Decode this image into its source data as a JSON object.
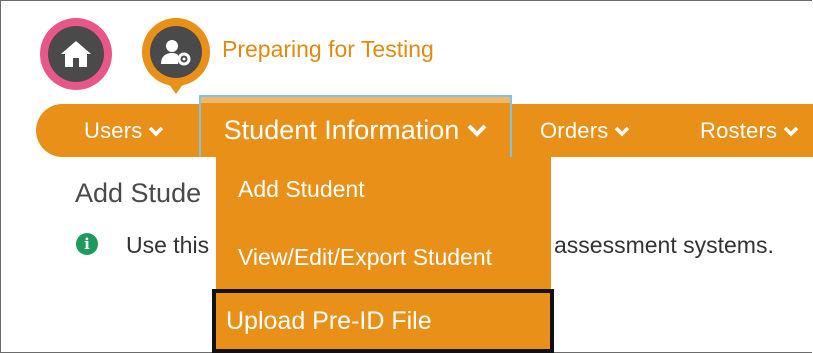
{
  "header": {
    "section_title": "Preparing for Testing",
    "home_icon": "home-icon",
    "section_icon": "user-gear-icon"
  },
  "nav": {
    "items": [
      {
        "label": "Users"
      },
      {
        "label": "Student Information"
      },
      {
        "label": "Orders"
      },
      {
        "label": "Rosters"
      }
    ]
  },
  "dropdown": {
    "items": [
      {
        "label": "Add Student"
      },
      {
        "label": "View/Edit/Export Student"
      },
      {
        "label": "Upload Pre-ID File"
      }
    ]
  },
  "page": {
    "title_visible": "Add Stude",
    "info_left_visible": "Use this",
    "info_right_visible": "assessment systems."
  },
  "colors": {
    "accent": "#e89018",
    "home_ring": "#e8568a",
    "info": "#1e9a5a",
    "highlight_border": "#7fc4e8"
  }
}
